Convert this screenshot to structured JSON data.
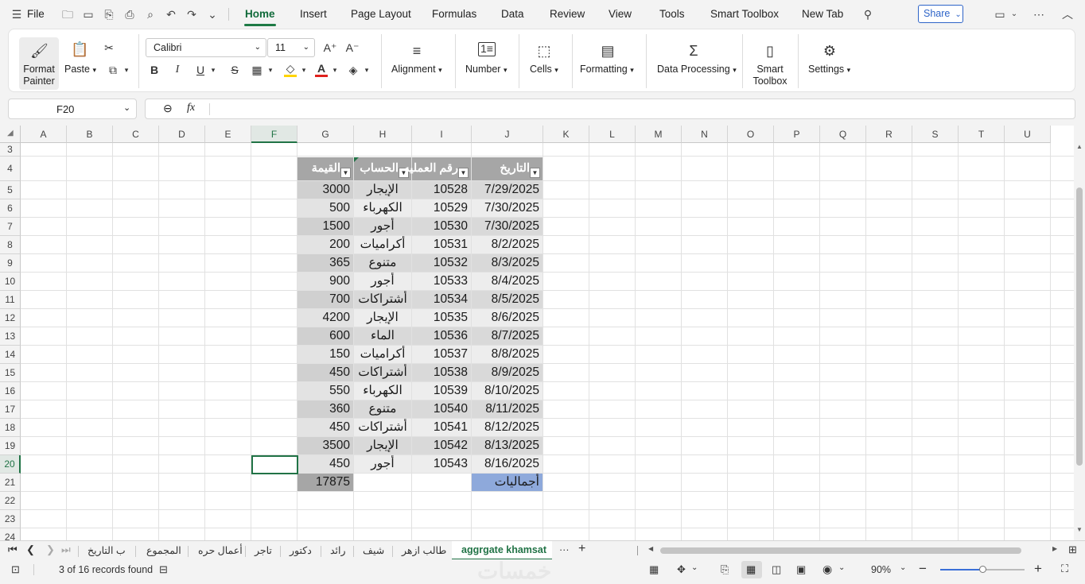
{
  "menu": {
    "file": "File",
    "tabs": [
      "Home",
      "Insert",
      "Page Layout",
      "Formulas",
      "Data",
      "Review",
      "View",
      "Tools",
      "Smart Toolbox",
      "New Tab"
    ],
    "share": "Share"
  },
  "ribbon": {
    "format_painter": "Format Painter",
    "paste": "Paste",
    "font_name": "Calibri",
    "font_size": "11",
    "alignment": "Alignment",
    "number": "Number",
    "cells": "Cells",
    "formatting": "Formatting",
    "data_processing": "Data Processing",
    "smart_toolbox": "Smart Toolbox",
    "settings": "Settings",
    "colors": {
      "highlight": "#ffd400",
      "font_color": "#e0211d",
      "accent": "#217346"
    }
  },
  "formula_bar": {
    "cell_ref": "F20",
    "fx": "fx",
    "content": ""
  },
  "columns": [
    "A",
    "B",
    "C",
    "D",
    "E",
    "F",
    "G",
    "H",
    "I",
    "J",
    "K",
    "L",
    "M",
    "N",
    "O",
    "P",
    "Q",
    "R",
    "S",
    "T",
    "U"
  ],
  "selected_column": "F",
  "rows": [
    "3",
    "4",
    "5",
    "6",
    "7",
    "8",
    "9",
    "10",
    "11",
    "12",
    "13",
    "14",
    "15",
    "16",
    "17",
    "18",
    "19",
    "20",
    "21",
    "22",
    "23",
    "24"
  ],
  "selected_row": "20",
  "table": {
    "headers": {
      "date": "التاريخ",
      "op_no": "رقم العمليه",
      "account": "الحساب",
      "value": "القيمة"
    },
    "records": [
      {
        "date": "7/29/2025",
        "op": "10528",
        "account": "الإيجار",
        "value": "3000"
      },
      {
        "date": "7/30/2025",
        "op": "10529",
        "account": "الكهرباء",
        "value": "500"
      },
      {
        "date": "7/30/2025",
        "op": "10530",
        "account": "أجور",
        "value": "1500"
      },
      {
        "date": "8/2/2025",
        "op": "10531",
        "account": "أكراميات",
        "value": "200"
      },
      {
        "date": "8/3/2025",
        "op": "10532",
        "account": "متنوع",
        "value": "365"
      },
      {
        "date": "8/4/2025",
        "op": "10533",
        "account": "أجور",
        "value": "900"
      },
      {
        "date": "8/5/2025",
        "op": "10534",
        "account": "أشتراكات",
        "value": "700"
      },
      {
        "date": "8/6/2025",
        "op": "10535",
        "account": "الإيجار",
        "value": "4200"
      },
      {
        "date": "8/7/2025",
        "op": "10536",
        "account": "الماء",
        "value": "600"
      },
      {
        "date": "8/8/2025",
        "op": "10537",
        "account": "أكراميات",
        "value": "150"
      },
      {
        "date": "8/9/2025",
        "op": "10538",
        "account": "أشتراكات",
        "value": "450"
      },
      {
        "date": "8/10/2025",
        "op": "10539",
        "account": "الكهرباء",
        "value": "550"
      },
      {
        "date": "8/11/2025",
        "op": "10540",
        "account": "متنوع",
        "value": "360"
      },
      {
        "date": "8/12/2025",
        "op": "10541",
        "account": "أشتراكات",
        "value": "450"
      },
      {
        "date": "8/13/2025",
        "op": "10542",
        "account": "الإيجار",
        "value": "3500"
      },
      {
        "date": "8/16/2025",
        "op": "10543",
        "account": "أجور",
        "value": "450"
      }
    ],
    "total_label": "أجماليات",
    "total_value": "17875"
  },
  "sheet_tabs": [
    "ب التاريخ",
    "المجموع",
    "أعمال حره",
    "تاجر",
    "دكتور",
    "رائد",
    "شيف",
    "طالب ازهر",
    "aggrgate khamsat"
  ],
  "more_tabs": "···",
  "add_tab": "+",
  "status": {
    "records": "3 of 16 records found",
    "zoom": "90%",
    "zoom_level": 0.5
  },
  "watermark": "خمسات"
}
